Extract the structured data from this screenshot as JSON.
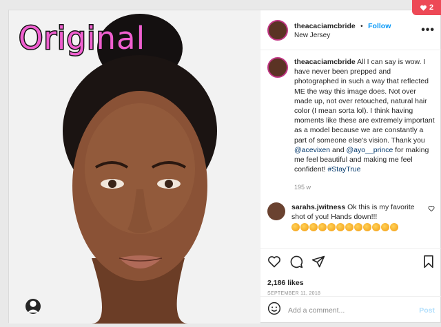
{
  "overlay": {
    "title": "Original"
  },
  "post": {
    "username": "theacaciamcbride",
    "separator": "•",
    "follow_label": "Follow",
    "location": "New Jersey",
    "more_label": "•••",
    "caption": {
      "username": "theacaciamcbride",
      "text_before": "All I can say is wow. I have never been prepped and photographed in such a way that reflected ME the way this image does. Not over made up, not over retouched, natural hair color (I mean sorta lol). I think having moments like these are extremely important as a model because we are constantly a part of someone else's vision. Thank you ",
      "mention1": "@acevixen",
      "text_and": " and ",
      "mention2": "@ayo__prince",
      "text_after": " for making me feel beautiful and making me feel confident! ",
      "hashtag": "#StayTrue",
      "age": "195 w"
    },
    "comment": {
      "username": "sarahs.jwitness",
      "text": "Ok this is my favorite shot of you! Hands down!!!"
    },
    "likes": "2,186 likes",
    "date": "SEPTEMBER 11, 2018",
    "add_comment_placeholder": "Add a comment...",
    "post_label": "Post"
  },
  "notification": {
    "count": "2",
    "color": "#ed4956"
  },
  "colors": {
    "accent": "#0095f6",
    "overlay_text": "#f05fd0"
  }
}
